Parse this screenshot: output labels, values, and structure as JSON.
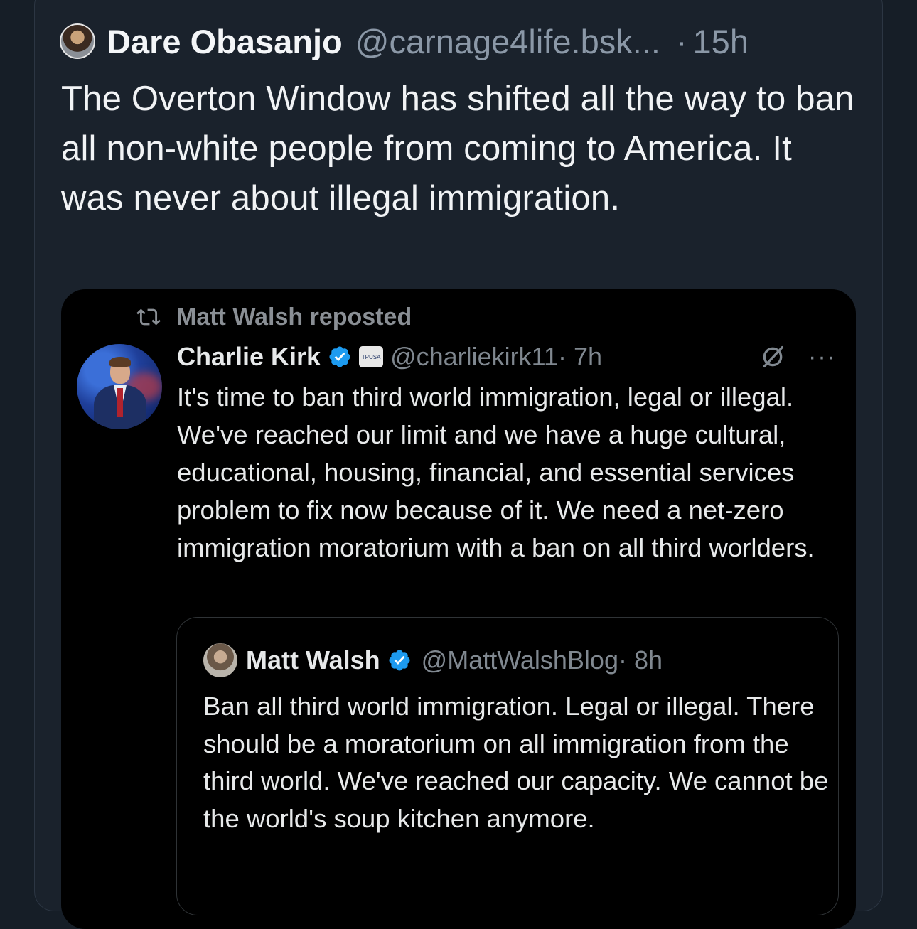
{
  "post": {
    "author_name": "Dare Obasanjo",
    "author_handle": "@carnage4life.bsk...",
    "separator": "·",
    "time": "15h",
    "text": "The Overton Window has shifted all the way to ban all non-white people from coming to America. It was never about illegal immigration."
  },
  "embedded_screenshot": {
    "repost_label": "Matt Walsh reposted",
    "tweet": {
      "author_name": "Charlie Kirk",
      "author_handle": "@charliekirk11",
      "time": "· 7h",
      "affiliation_badge_text": "TPUSA",
      "text": "It's time to ban third world immigration, legal or illegal. We've reached our limit and we have a huge cultural, educational, housing, financial, and essential services problem to fix now because of it. We need a net-zero immigration moratorium with a ban on all third worlders."
    },
    "quoted_tweet": {
      "author_name": "Matt Walsh",
      "author_handle": "@MattWalshBlog",
      "time": "· 8h",
      "text": "Ban all third world immigration. Legal or illegal. There should be a moratorium on all immigration from the third world. We've reached our capacity. We cannot be the world's soup kitchen anymore."
    },
    "more_label": "···"
  },
  "colors": {
    "background": "#161e27",
    "card": "#1a222c",
    "screenshot_background": "#000000",
    "verified_blue": "#1d9bf0",
    "secondary_text": "#8b98a7"
  }
}
